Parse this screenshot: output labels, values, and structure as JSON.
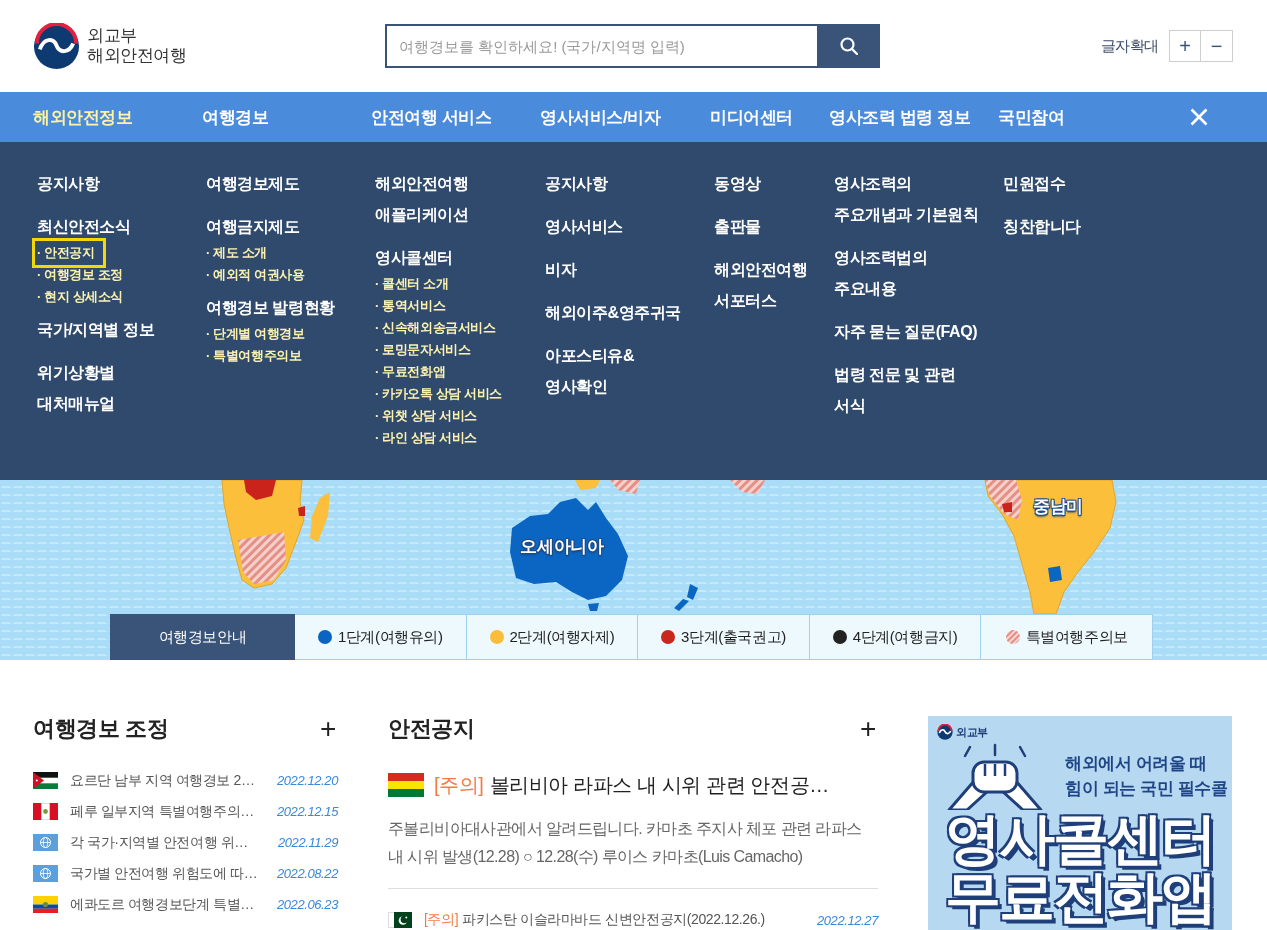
{
  "header": {
    "logo_line1": "외교부",
    "logo_line2": "해외안전여행",
    "search": {
      "placeholder": "여행경보를 확인하세요! (국가/지역명 입력)"
    },
    "font_size_label": "글자확대",
    "font_buttons": [
      "+",
      "−"
    ]
  },
  "nav": {
    "items": [
      {
        "label": "해외안전정보",
        "selected": true
      },
      {
        "label": "여행경보",
        "selected": false
      },
      {
        "label": "안전여행 서비스",
        "selected": false
      },
      {
        "label": "영사서비스/비자",
        "selected": false
      },
      {
        "label": "미디어센터",
        "selected": false
      },
      {
        "label": "영사조력 법령 정보",
        "selected": false
      },
      {
        "label": "국민참여",
        "selected": false
      }
    ]
  },
  "menu": {
    "columns": [
      {
        "items": [
          {
            "lines": [
              "공지사항"
            ]
          },
          {
            "lines": [
              "최신안전소식"
            ],
            "children": [
              {
                "label": "· 안전공지",
                "focused": true
              },
              {
                "label": "· 여행경보 조정",
                "focused": false
              },
              {
                "label": "· 현지 상세소식",
                "focused": false
              }
            ]
          },
          {
            "lines": [
              "국가/지역별 정보"
            ]
          },
          {
            "lines": [
              "위기상황별",
              "대처매뉴얼"
            ]
          }
        ]
      },
      {
        "items": [
          {
            "lines": [
              "여행경보제도"
            ]
          },
          {
            "lines": [
              "여행금지제도"
            ],
            "children": [
              {
                "label": "· 제도 소개",
                "focused": false
              },
              {
                "label": "· 예외적 여권사용",
                "focused": false
              }
            ]
          },
          {
            "lines": [
              "여행경보 발령현황"
            ],
            "children": [
              {
                "label": "· 단계별 여행경보",
                "focused": false
              },
              {
                "label": "· 특별여행주의보",
                "focused": false
              }
            ]
          }
        ]
      },
      {
        "items": [
          {
            "lines": [
              "해외안전여행",
              "애플리케이션"
            ]
          },
          {
            "lines": [
              "영사콜센터"
            ],
            "children": [
              {
                "label": "· 콜센터 소개",
                "focused": false
              },
              {
                "label": "· 통역서비스",
                "focused": false
              },
              {
                "label": "· 신속해외송금서비스",
                "focused": false
              },
              {
                "label": "· 로밍문자서비스",
                "focused": false
              },
              {
                "label": "· 무료전화앱",
                "focused": false
              },
              {
                "label": "· 카카오톡 상담 서비스",
                "focused": false
              },
              {
                "label": "· 위챗 상담 서비스",
                "focused": false
              },
              {
                "label": "· 라인 상담 서비스",
                "focused": false
              }
            ]
          }
        ]
      },
      {
        "items": [
          {
            "lines": [
              "공지사항"
            ]
          },
          {
            "lines": [
              "영사서비스"
            ]
          },
          {
            "lines": [
              "비자"
            ]
          },
          {
            "lines": [
              "해외이주&영주귀국"
            ]
          },
          {
            "lines": [
              "아포스티유&",
              "영사확인"
            ]
          }
        ]
      },
      {
        "items": [
          {
            "lines": [
              "동영상"
            ]
          },
          {
            "lines": [
              "출판물"
            ]
          },
          {
            "lines": [
              "해외안전여행",
              "서포터스"
            ]
          }
        ]
      },
      {
        "items": [
          {
            "lines": [
              "영사조력의",
              "주요개념과 기본원칙"
            ]
          },
          {
            "lines": [
              "영사조력법의",
              "주요내용"
            ]
          },
          {
            "lines": [
              "자주 묻는 질문(FAQ)"
            ]
          },
          {
            "lines": [
              "법령 전문 및 관련",
              "서식"
            ]
          }
        ]
      },
      {
        "items": [
          {
            "lines": [
              "민원접수"
            ]
          },
          {
            "lines": [
              "칭찬합니다"
            ]
          }
        ]
      }
    ]
  },
  "map": {
    "region_labels": [
      {
        "label": "오세아니아"
      },
      {
        "label": "중남미"
      }
    ]
  },
  "legend": {
    "title": "여행경보안내",
    "items": [
      {
        "label": "1단계(여행유의)",
        "kind": "dot",
        "color": "#0a64c2"
      },
      {
        "label": "2단계(여행자제)",
        "kind": "dot",
        "color": "#f9bd3b"
      },
      {
        "label": "3단계(출국권고)",
        "kind": "dot",
        "color": "#c9261c"
      },
      {
        "label": "4단계(여행금지)",
        "kind": "dot",
        "color": "#222222"
      },
      {
        "label": "특별여행주의보",
        "kind": "hatched",
        "color": "#e58c84"
      }
    ]
  },
  "travel_alerts": {
    "title": "여행경보 조정",
    "more": "+",
    "items": [
      {
        "kind": "jordan",
        "title": "요르단 남부 지역 여행경보 2…",
        "date": "2022.12.20"
      },
      {
        "kind": "peru",
        "title": "페루 일부지역 특별여행주의…",
        "date": "2022.12.15"
      },
      {
        "kind": "globe",
        "title": "각 국가·지역별 안전여행 위…",
        "date": "2022.11.29"
      },
      {
        "kind": "globe",
        "title": "국가별 안전여행 위험도에 따…",
        "date": "2022.08.22"
      },
      {
        "kind": "ecuador",
        "title": "에콰도르 여행경보단계 특별…",
        "date": "2022.06.23"
      }
    ]
  },
  "safety_notices": {
    "title": "안전공지",
    "more": "+",
    "featured": {
      "kind": "bolivia",
      "tag": "[주의]",
      "title": "볼리비아 라파스 내 시위 관련 안전공…",
      "summary": "주볼리비아대사관에서 알려드립니다. 카마초 주지사 체포 관련 라파스 내 시위 발생(12.28) ○ 12.28(수) 루이스 카마초(Luis Camacho)"
    },
    "items": [
      {
        "kind": "pakistan",
        "tag": "[주의]",
        "title": "파키스탄 이슬라마바드 신변안전공지(2022.12.26.)",
        "date": "2022.12.27"
      }
    ]
  },
  "banner": {
    "brand": "외교부",
    "tagline_1": "해외에서 어려울 때",
    "tagline_2": "힘이 되는 국민 필수콜",
    "headline_1": "영사콜센터",
    "headline_2": "무료전화앱"
  }
}
